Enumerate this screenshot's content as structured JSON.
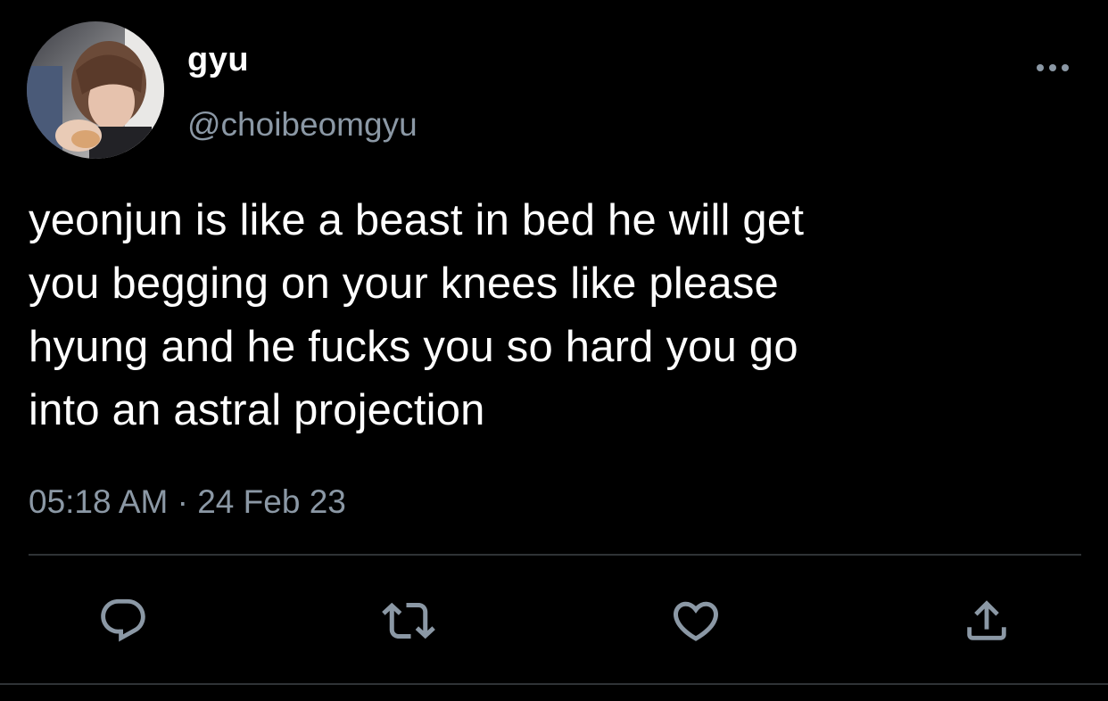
{
  "author": {
    "display_name": "gyu",
    "handle": "@choibeomgyu",
    "avatar_icon": "profile-photo"
  },
  "tweet": {
    "text": "yeonjun is like a beast in bed he will get\nyou begging on your knees like please\nhyung and he fucks you so hard you go\ninto an astral projection",
    "time": "05:18 AM",
    "separator": " · ",
    "date": "24 Feb 23"
  },
  "actions": {
    "reply_icon": "reply-icon",
    "retweet_icon": "retweet-icon",
    "like_icon": "like-icon",
    "share_icon": "share-icon",
    "more_icon": "more-icon"
  },
  "colors": {
    "background": "#000000",
    "text_primary": "#ffffff",
    "text_secondary": "#8b98a5",
    "divider": "#2f3336"
  }
}
